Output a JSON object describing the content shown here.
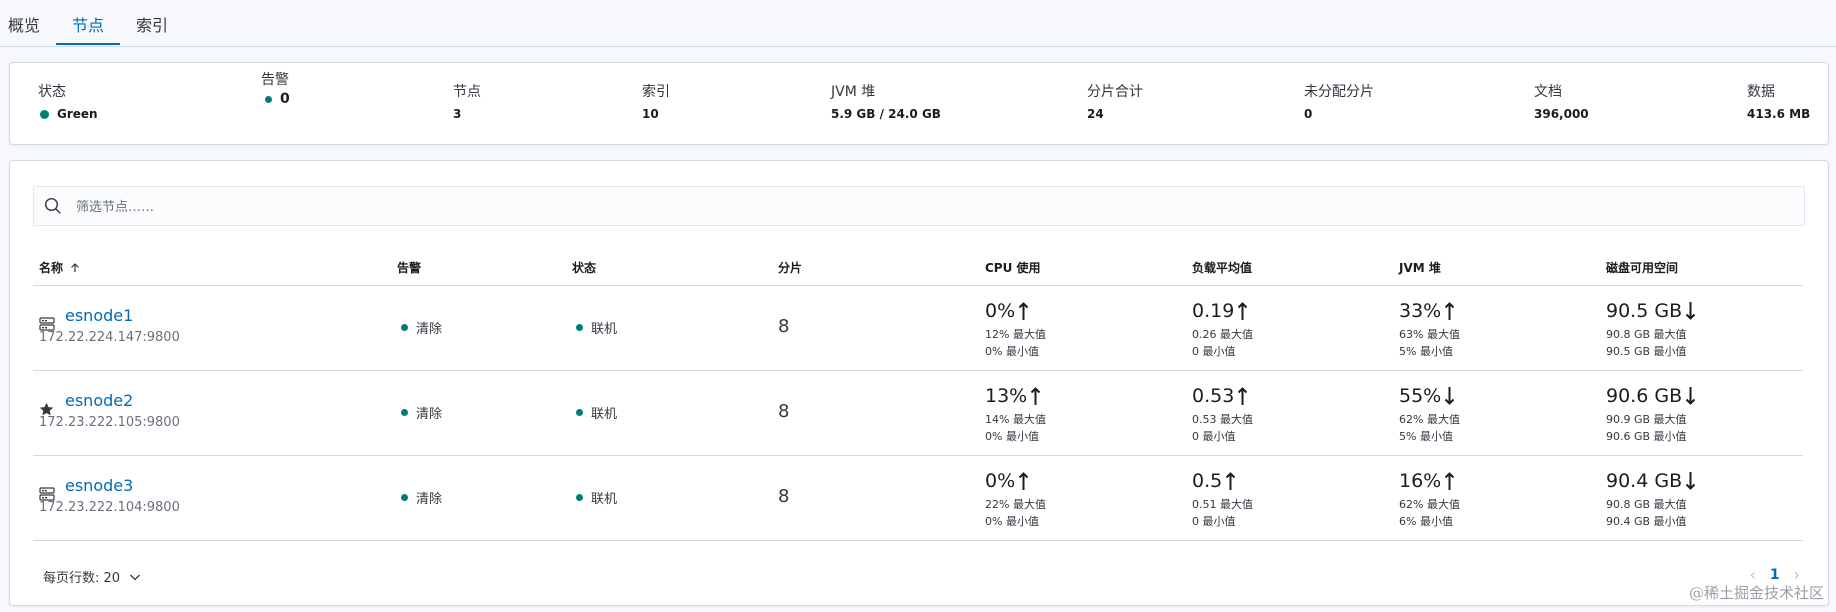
{
  "tabs": [
    {
      "label": "概览"
    },
    {
      "label": "节点"
    },
    {
      "label": "索引"
    }
  ],
  "summary": {
    "status": {
      "label": "状态",
      "value": "Green"
    },
    "alerts": {
      "label": "告警",
      "value": "0"
    },
    "nodes": {
      "label": "节点",
      "value": "3"
    },
    "indices": {
      "label": "索引",
      "value": "10"
    },
    "jvm": {
      "label": "JVM 堆",
      "value": "5.9 GB / 24.0 GB"
    },
    "shards_total": {
      "label": "分片合计",
      "value": "24"
    },
    "unassigned": {
      "label": "未分配分片",
      "value": "0"
    },
    "documents": {
      "label": "文档",
      "value": "396,000"
    },
    "data": {
      "label": "数据",
      "value": "413.6 MB"
    }
  },
  "search": {
    "placeholder": "筛选节点……"
  },
  "table": {
    "headers": {
      "name": "名称",
      "alerts": "告警",
      "status": "状态",
      "shards": "分片",
      "cpu": "CPU 使用",
      "load": "负载平均值",
      "jvm": "JVM 堆",
      "disk": "磁盘可用空间"
    },
    "rows": [
      {
        "icon": "server-icon",
        "name": "esnode1",
        "address": "172.22.224.147:9800",
        "alerts": "清除",
        "status": "联机",
        "shards": "8",
        "cpu": {
          "value": "0%",
          "trend": "up",
          "max": "12% 最大值",
          "min": "0% 最小值"
        },
        "load": {
          "value": "0.19",
          "trend": "up",
          "max": "0.26 最大值",
          "min": "0 最小值"
        },
        "jvm": {
          "value": "33%",
          "trend": "up",
          "max": "63% 最大值",
          "min": "5% 最小值"
        },
        "disk": {
          "value": "90.5 GB",
          "trend": "down",
          "max": "90.8 GB 最大值",
          "min": "90.5 GB 最小值"
        }
      },
      {
        "icon": "star-icon",
        "name": "esnode2",
        "address": "172.23.222.105:9800",
        "alerts": "清除",
        "status": "联机",
        "shards": "8",
        "cpu": {
          "value": "13%",
          "trend": "up",
          "max": "14% 最大值",
          "min": "0% 最小值"
        },
        "load": {
          "value": "0.53",
          "trend": "up",
          "max": "0.53 最大值",
          "min": "0 最小值"
        },
        "jvm": {
          "value": "55%",
          "trend": "down",
          "max": "62% 最大值",
          "min": "5% 最小值"
        },
        "disk": {
          "value": "90.6 GB",
          "trend": "down",
          "max": "90.9 GB 最大值",
          "min": "90.6 GB 最小值"
        }
      },
      {
        "icon": "server-icon",
        "name": "esnode3",
        "address": "172.23.222.104:9800",
        "alerts": "清除",
        "status": "联机",
        "shards": "8",
        "cpu": {
          "value": "0%",
          "trend": "up",
          "max": "22% 最大值",
          "min": "0% 最小值"
        },
        "load": {
          "value": "0.5",
          "trend": "up",
          "max": "0.51 最大值",
          "min": "0 最小值"
        },
        "jvm": {
          "value": "16%",
          "trend": "up",
          "max": "62% 最大值",
          "min": "6% 最小值"
        },
        "disk": {
          "value": "90.4 GB",
          "trend": "down",
          "max": "90.8 GB 最大值",
          "min": "90.4 GB 最小值"
        }
      }
    ]
  },
  "footer": {
    "rows_per_page": "每页行数: 20"
  },
  "pagination": {
    "current": "1"
  },
  "watermark": "@稀土掘金技术社区",
  "colors": {
    "accent": "#006bb8",
    "status_green": "#017d73"
  }
}
